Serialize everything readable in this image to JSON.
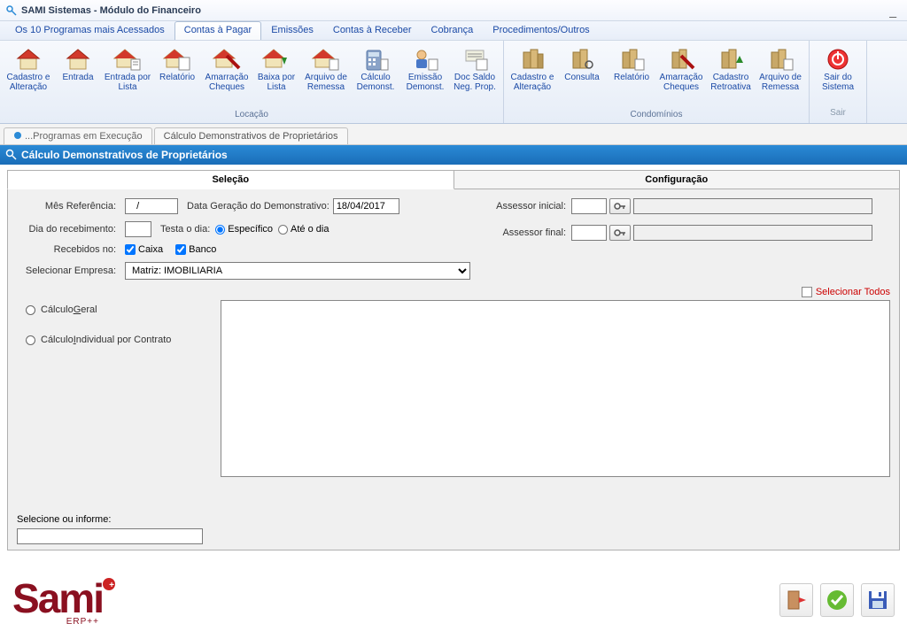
{
  "window": {
    "title": "SAMI Sistemas - Módulo do Financeiro"
  },
  "menu": {
    "items": [
      "Os 10 Programas mais Acessados",
      "Contas à Pagar",
      "Emissões",
      "Contas à Receber",
      "Cobrança",
      "Procedimentos/Outros"
    ],
    "active_index": 1
  },
  "ribbon": {
    "group_locacao_label": "Locação",
    "group_condominios_label": "Condomínios",
    "group_sair_label": "Sair",
    "locacao": [
      "Cadastro e Alteração",
      "Entrada",
      "Entrada por Lista",
      "Relatório",
      "Amarração Cheques",
      "Baixa por Lista",
      "Arquivo de Remessa",
      "Cálculo Demonst.",
      "Emissão Demonst.",
      "Doc Saldo Neg. Prop."
    ],
    "condominios": [
      "Cadastro e Alteração",
      "Consulta",
      "Relatório",
      "Amarração Cheques",
      "Cadastro Retroativa",
      "Arquivo de Remessa"
    ],
    "sair": "Sair do Sistema"
  },
  "subtabs": {
    "items": [
      "...Programas em Execução",
      "Cálculo Demonstrativos de Proprietários"
    ],
    "active_index": 1
  },
  "form": {
    "title": "Cálculo Demonstrativos de Proprietários",
    "tabs": [
      "Seleção",
      "Configuração"
    ],
    "active_tab": 0
  },
  "labels": {
    "mes_ref": "Mês Referência:",
    "data_geracao": "Data Geração do Demonstrativo:",
    "dia_receb": "Dia do recebimento:",
    "testa_dia": "Testa o dia:",
    "especifico": "Específico",
    "ate_dia": "Até o dia",
    "recebidos_no": "Recebidos no:",
    "caixa": "Caixa",
    "banco": "Banco",
    "sel_empresa": "Selecionar Empresa:",
    "assessor_ini": "Assessor inicial:",
    "assessor_fin": "Assessor final:",
    "sel_todos": "Selecionar Todos",
    "calc_geral_pre": "Cálculo ",
    "calc_geral_u": "G",
    "calc_geral_post": "eral",
    "calc_ind_pre": "Cálculo ",
    "calc_ind_u": "I",
    "calc_ind_post": "ndividual por Contrato",
    "selecione_informe": "Selecione ou informe:"
  },
  "values": {
    "mes_ref": "   /",
    "data_geracao": "18/04/2017",
    "dia_receb": "",
    "empresa": "Matriz: IMOBILIARIA",
    "assessor_ini": "",
    "assessor_ini_desc": "",
    "assessor_fin": "",
    "assessor_fin_desc": ""
  },
  "logo": {
    "erp": "ERP++"
  }
}
